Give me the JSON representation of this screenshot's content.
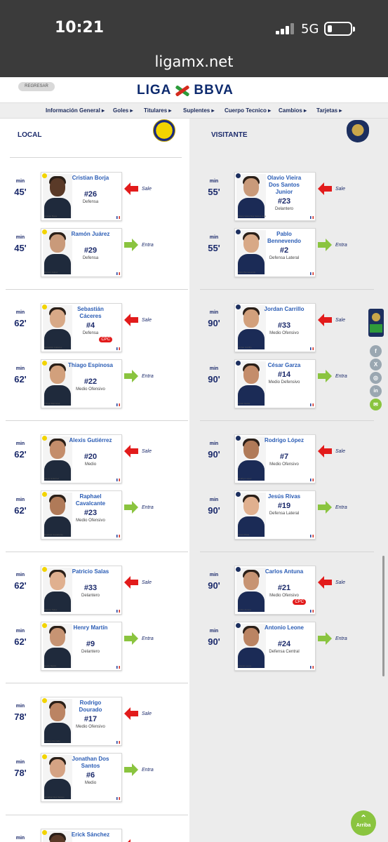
{
  "status": {
    "time": "10:21",
    "network": "5G"
  },
  "browser": {
    "url": "ligamx.net"
  },
  "header": {
    "back_label": "REGRESAR",
    "logo_left": "LIGA",
    "logo_right": "BBVA"
  },
  "nav": [
    "Información General",
    "Goles",
    "Titulares",
    "Suplentes",
    "Cuerpo Tecnico",
    "Cambios",
    "Tarjetas"
  ],
  "columns": {
    "local": "LOCAL",
    "visitante": "VISITANTE"
  },
  "min_label": "min",
  "actions": {
    "out": "Sale",
    "in": "Entra"
  },
  "cpc_label": "CPC",
  "colors": {
    "out_arrow": "#e21b1b",
    "in_arrow": "#8ac43f",
    "navy": "#1b2a6b",
    "name_blue": "#2b5db5"
  },
  "local_changes": [
    {
      "out": {
        "min": "45'",
        "name": "Cristian Borja",
        "number": "#26",
        "position": "Defensa"
      },
      "in": {
        "min": "45'",
        "name": "Ramón Juárez",
        "number": "#29",
        "position": "Defensa"
      }
    },
    {
      "out": {
        "min": "62'",
        "name": "Sebastián Cáceres",
        "number": "#4",
        "position": "Defensa",
        "cpc": true
      },
      "in": {
        "min": "62'",
        "name": "Thiago Espinosa",
        "number": "#22",
        "position": "Medio Ofensivo"
      }
    },
    {
      "out": {
        "min": "62'",
        "name": "Alexis Gutiérrez",
        "number": "#20",
        "position": "Medio"
      },
      "in": {
        "min": "62'",
        "name": "Raphael Cavalcante",
        "number": "#23",
        "position": "Medio Ofensivo"
      }
    },
    {
      "out": {
        "min": "62'",
        "name": "Patricio Salas",
        "number": "#33",
        "position": "Delantero"
      },
      "in": {
        "min": "62'",
        "name": "Henry Martín",
        "number": "#9",
        "position": "Delantero"
      }
    },
    {
      "out": {
        "min": "78'",
        "name": "Rodrigo Dourado",
        "number": "#17",
        "position": "Medio Ofensivo"
      },
      "in": {
        "min": "78'",
        "name": "Jonathan Dos Santos",
        "number": "#6",
        "position": "Medio"
      }
    },
    {
      "out": {
        "min": "",
        "name": "Erick Sánchez",
        "number": "",
        "position": ""
      }
    }
  ],
  "visitor_changes": [
    {
      "out": {
        "min": "55'",
        "name": "Olavio Vieira Dos Santos Junior",
        "number": "#23",
        "position": "Delantero"
      },
      "in": {
        "min": "55'",
        "name": "Pablo Bennevendo",
        "number": "#2",
        "position": "Defensa Lateral"
      }
    },
    {
      "out": {
        "min": "90'",
        "name": "Jordan Carrillo",
        "number": "#33",
        "position": "Medio Ofensivo"
      },
      "in": {
        "min": "90'",
        "name": "César Garza",
        "number": "#14",
        "position": "Medio Defensivo"
      }
    },
    {
      "out": {
        "min": "90'",
        "name": "Rodrigo López",
        "number": "#7",
        "position": "Medio Ofensivo"
      },
      "in": {
        "min": "90'",
        "name": "Jesús Rivas",
        "number": "#19",
        "position": "Defensa Lateral"
      }
    },
    {
      "out": {
        "min": "90'",
        "name": "Carlos Antuna",
        "number": "#21",
        "position": "Medio Ofensivo",
        "cpc": true
      },
      "in": {
        "min": "90'",
        "name": "Antonio Leone",
        "number": "#24",
        "position": "Defensa Central"
      }
    }
  ],
  "social": [
    "f",
    "X",
    "◎",
    "in",
    "✉"
  ],
  "scroll_top_label": "Arriba"
}
